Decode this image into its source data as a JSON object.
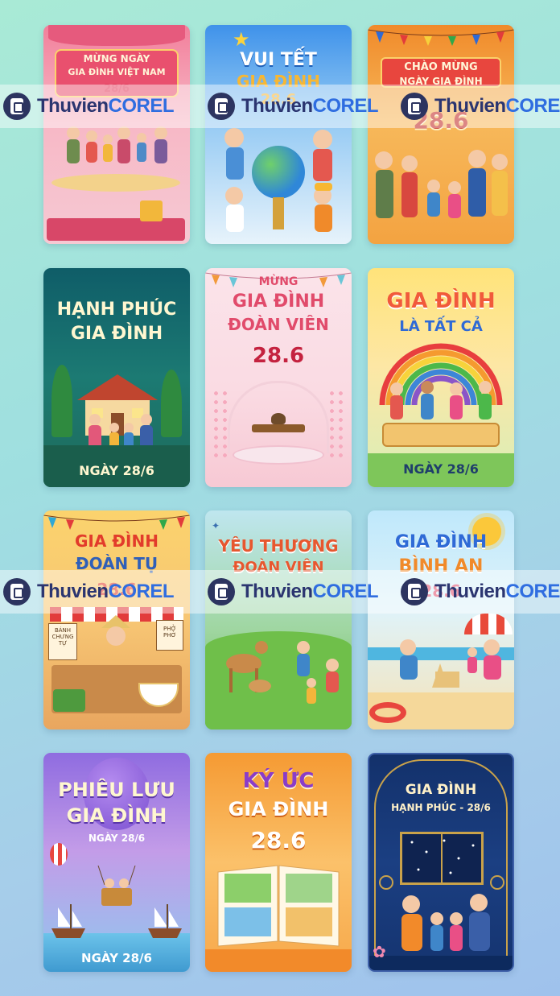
{
  "cards": [
    {
      "title1": "MỪNG NGÀY",
      "title2": "GIA ĐÌNH VIỆT NAM",
      "title3": "28/6"
    },
    {
      "title1": "VUI TẾT",
      "title2": "GIA ĐÌNH",
      "title3": "28.6"
    },
    {
      "title1": "CHÀO MỪNG",
      "title2": "NGÀY GIA ĐÌNH",
      "title3": "28.6"
    },
    {
      "title1": "HẠNH PHÚC",
      "title2": "GIA ĐÌNH",
      "date": "NGÀY 28/6"
    },
    {
      "title1": "MỪNG",
      "title2": "GIA ĐÌNH",
      "title3": "ĐOÀN VIÊN",
      "title4": "28.6"
    },
    {
      "title1": "GIA ĐÌNH",
      "title2": "LÀ TẤT CẢ",
      "date": "NGÀY 28/6"
    },
    {
      "title1": "GIA ĐÌNH",
      "title2": "ĐOÀN TỤ",
      "title3": "28.6",
      "sign1": "BÁNH CHƯNG TỰ",
      "sign2": "PHỞ PHỞ"
    },
    {
      "title1": "YÊU THƯƠNG",
      "title2": "ĐOÀN VIÊN"
    },
    {
      "title1": "GIA ĐÌNH",
      "title2": "BÌNH AN",
      "title3": "28.6"
    },
    {
      "title1": "PHIÊU LƯU",
      "title2": "GIA ĐÌNH",
      "title3": "NGÀY 28/6",
      "date": "NGÀY 28/6"
    },
    {
      "title1": "KÝ ỨC",
      "title2": "GIA ĐÌNH",
      "title3": "28.6"
    },
    {
      "title1": "GIA ĐÌNH",
      "title2": "HẠNH PHÚC - 28/6"
    }
  ],
  "watermark": {
    "part1": "Thuvien",
    "part2": "COREL"
  }
}
